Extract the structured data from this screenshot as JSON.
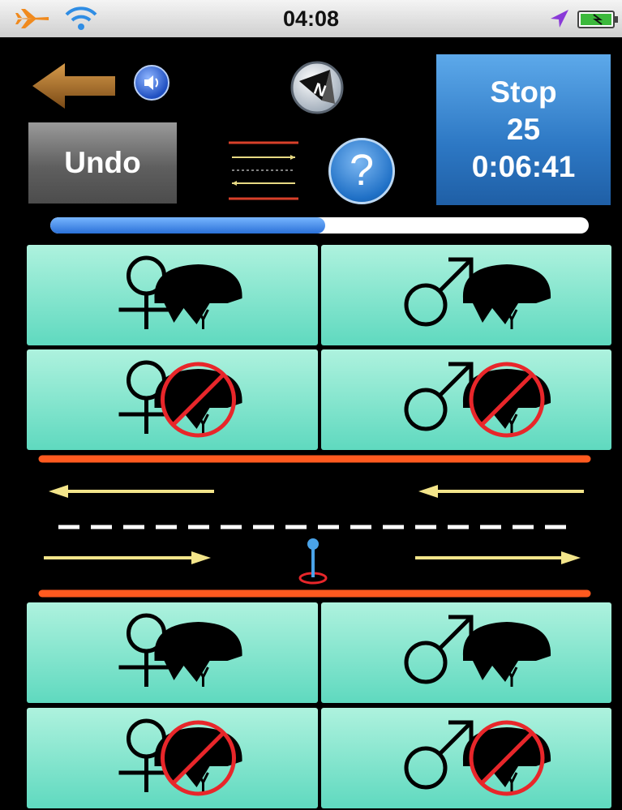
{
  "status_bar": {
    "time": "04:08",
    "icons": [
      "airplane-icon",
      "wifi-icon",
      "location-arrow-icon",
      "battery-icon"
    ]
  },
  "controls": {
    "back_icon": "back-arrow-icon",
    "sound_icon": "speaker-icon",
    "compass_icon": "compass-icon",
    "undo_label": "Undo",
    "road_icon": "road-direction-icon",
    "help_label": "?",
    "stop": {
      "label": "Stop",
      "count": "25",
      "elapsed": "0:06:41"
    }
  },
  "progress": {
    "fraction": 0.51
  },
  "counters": [
    {
      "id": "female-helmet-top",
      "gender": "female",
      "helmet": true
    },
    {
      "id": "male-helmet-top",
      "gender": "male",
      "helmet": true
    },
    {
      "id": "female-no-helmet-top",
      "gender": "female",
      "helmet": false
    },
    {
      "id": "male-no-helmet-top",
      "gender": "male",
      "helmet": false
    },
    {
      "id": "female-helmet-bottom",
      "gender": "female",
      "helmet": true
    },
    {
      "id": "male-helmet-bottom",
      "gender": "male",
      "helmet": true
    },
    {
      "id": "female-no-helmet-bottom",
      "gender": "female",
      "helmet": false
    },
    {
      "id": "male-no-helmet-bottom",
      "gender": "male",
      "helmet": false
    }
  ],
  "colors": {
    "counter_button": "#7ee6cd",
    "stop_button": "#3a8ad6",
    "road_edge": "#ff5a1f",
    "lane_arrow": "#f3e58a",
    "no_symbol": "#e8262a",
    "marker": "#4aa3e8"
  }
}
